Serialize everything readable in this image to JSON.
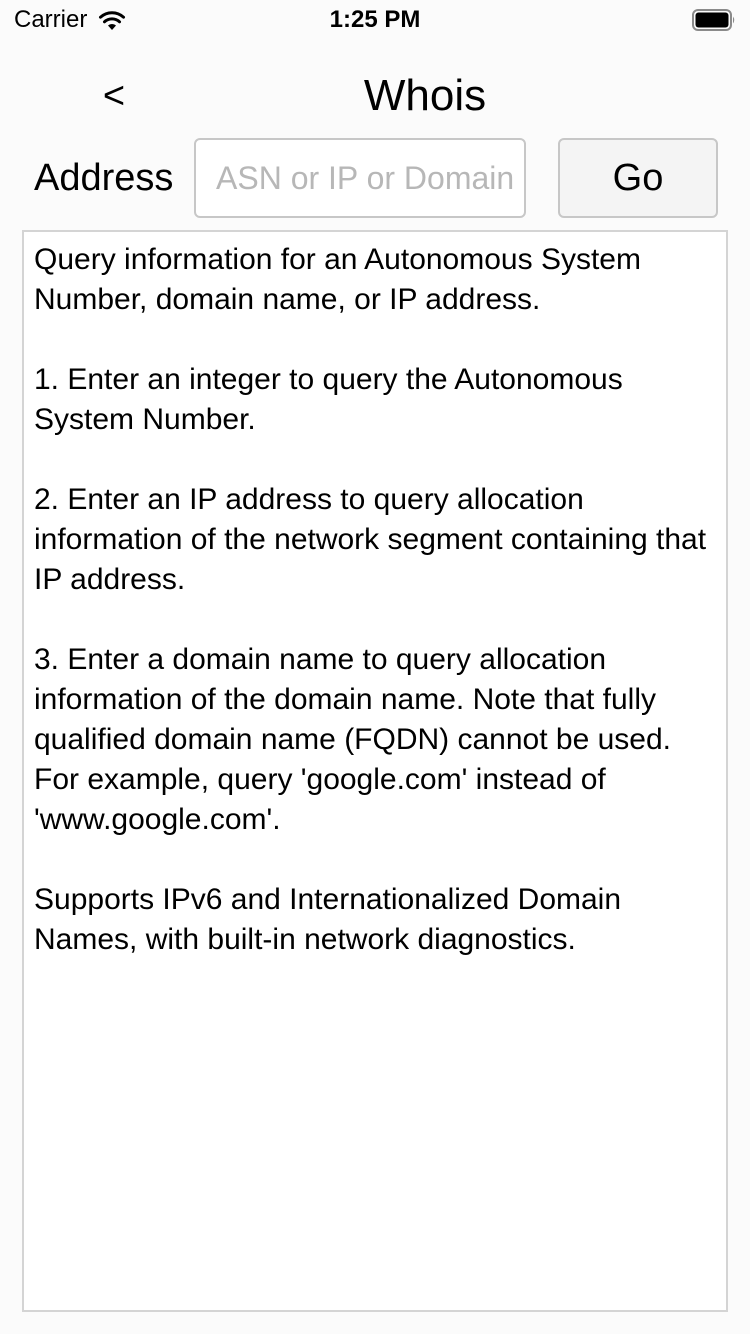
{
  "status_bar": {
    "carrier": "Carrier",
    "time": "1:25 PM",
    "wifi_icon": "wifi-icon",
    "battery_icon": "battery-icon"
  },
  "nav": {
    "back_label": "<",
    "title": "Whois"
  },
  "form": {
    "address_label": "Address",
    "address_value": "",
    "address_placeholder": "ASN or IP or Domain",
    "go_label": "Go"
  },
  "output": {
    "paragraphs": [
      "Query information for an Autonomous System Number, domain name, or IP address.",
      "1. Enter an integer to query the Autonomous System Number.",
      "2. Enter an IP address to query allocation information of the network segment containing that IP address.",
      "3. Enter a domain name to query allocation information of the domain name. Note that fully qualified domain name (FQDN) cannot be used. For example, query 'google.com' instead of 'www.google.com'.",
      "Supports IPv6 and Internationalized Domain Names, with built-in network diagnostics."
    ]
  }
}
